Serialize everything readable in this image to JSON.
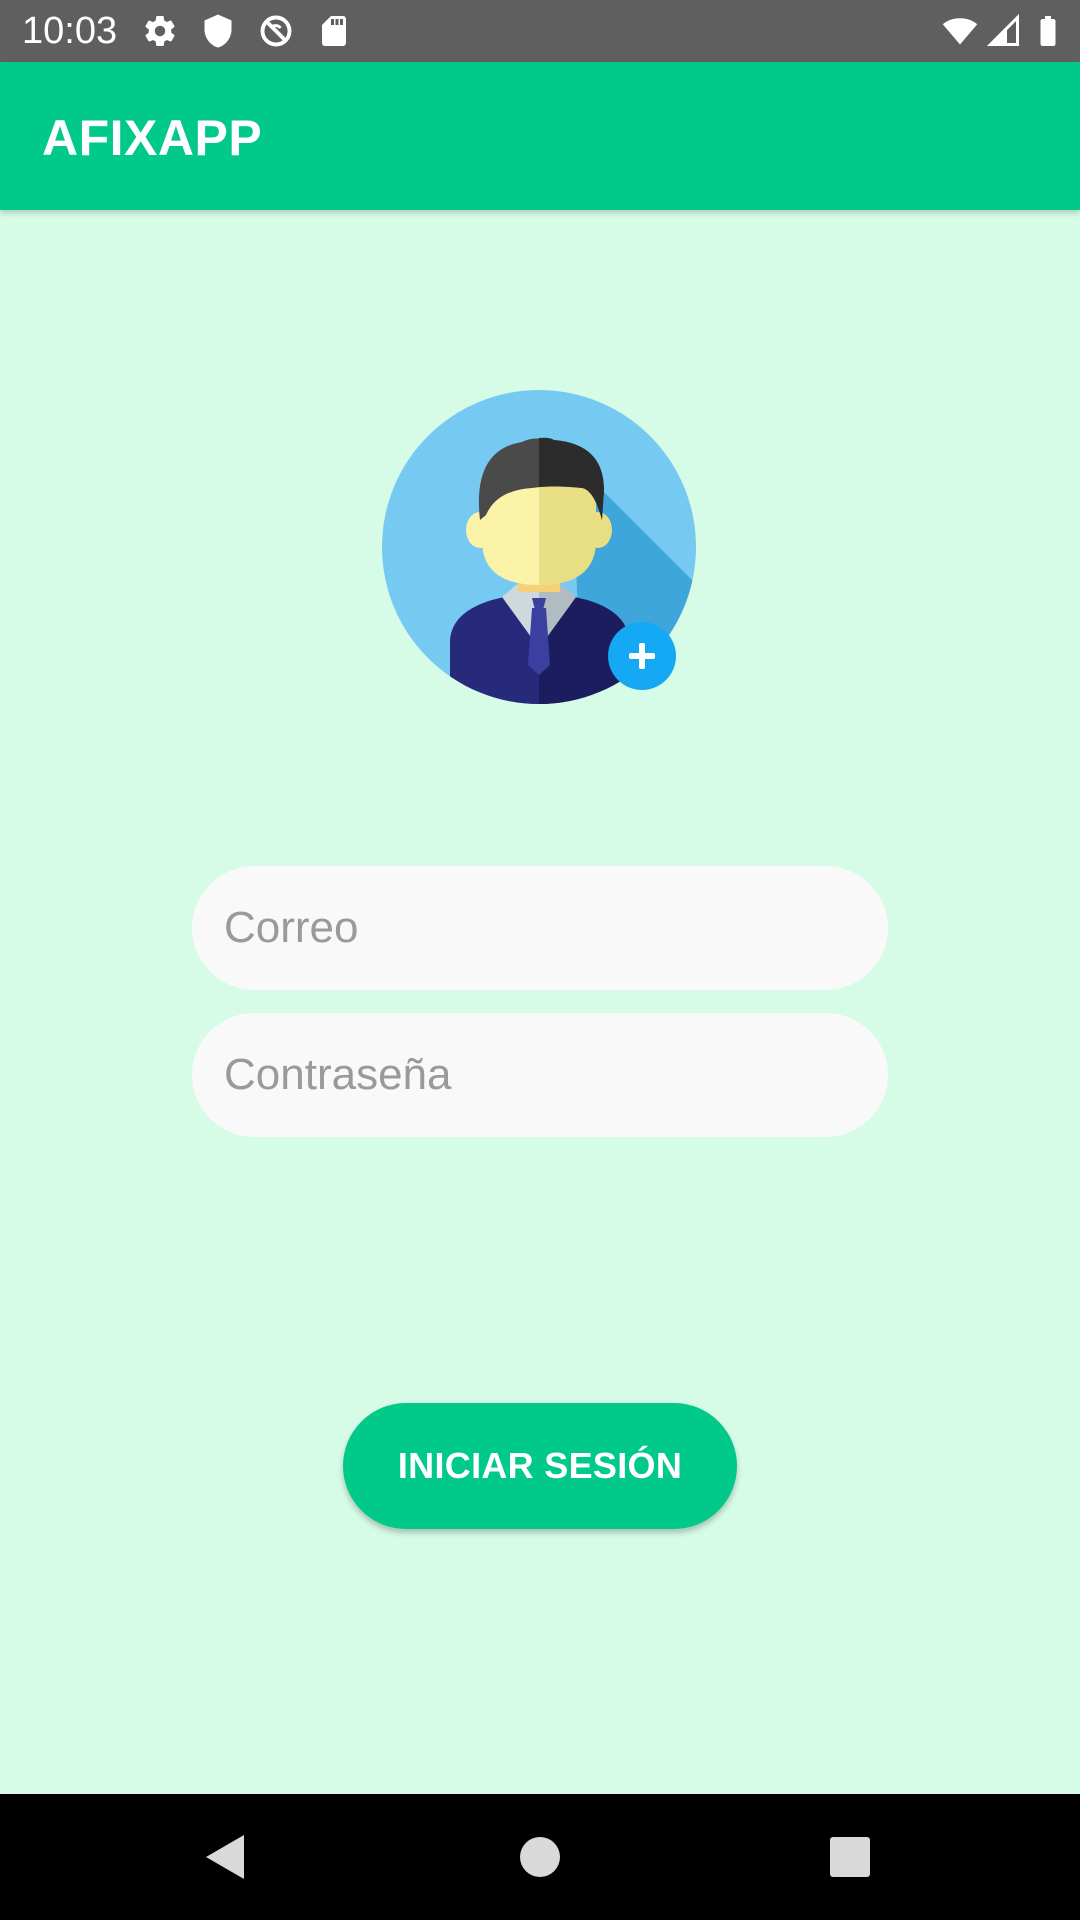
{
  "status_bar": {
    "time": "10:03",
    "left_icons": [
      "settings-icon",
      "shield-icon",
      "no-sync-icon",
      "sd-card-icon"
    ],
    "right_icons": [
      "wifi-icon",
      "cell-signal-icon",
      "battery-icon"
    ]
  },
  "app_bar": {
    "title": "AFIXAPP",
    "color": "#00c98a"
  },
  "avatar": {
    "icon": "user-avatar-icon",
    "badge_icon": "add-icon"
  },
  "form": {
    "email_placeholder": "Correo",
    "password_placeholder": "Contraseña",
    "email_value": "",
    "password_value": ""
  },
  "login_button": {
    "label": "INICIAR SESIÓN"
  },
  "nav_bar": {
    "buttons": [
      "back-icon",
      "home-icon",
      "recents-icon"
    ]
  },
  "colors": {
    "background": "#d6fbe6",
    "accent": "#00c98a",
    "field_bg": "#f9f9f9"
  }
}
